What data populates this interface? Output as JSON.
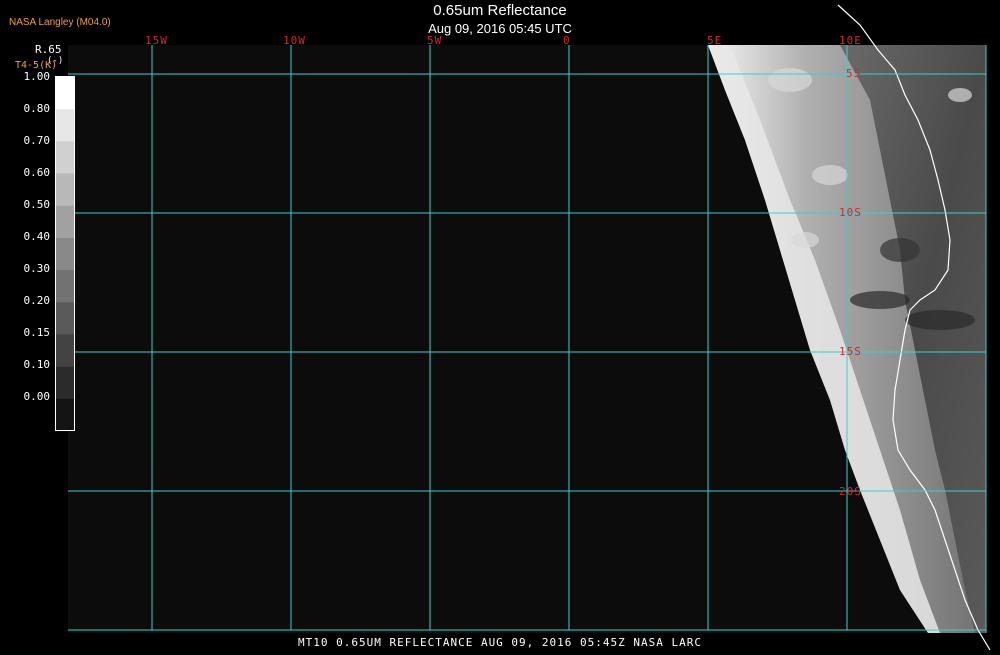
{
  "header": {
    "credit": "NASA Langley (M04.0)",
    "title": "0.65um Reflectance",
    "subtitle": "Aug 09, 2016 05:45 UTC"
  },
  "colorbar": {
    "title": "R.65",
    "unit": "(-)",
    "alt_label": "T4-5(K)",
    "ticks": [
      "1.00",
      "0.80",
      "0.70",
      "0.60",
      "0.50",
      "0.40",
      "0.30",
      "0.20",
      "0.15",
      "0.10",
      "0.00"
    ]
  },
  "map": {
    "longitude_labels": [
      "15W",
      "10W",
      "5W",
      "0",
      "5E",
      "10E"
    ],
    "latitude_labels": [
      "5S",
      "10S",
      "15S",
      "20S"
    ],
    "grid_color": "#38d0d0",
    "label_color": "#d42828",
    "background_color": "#0c0c0c"
  },
  "footer": {
    "text": "MT10  0.65UM REFLECTANCE   AUG 09, 2016 05:45Z   NASA LARC"
  }
}
